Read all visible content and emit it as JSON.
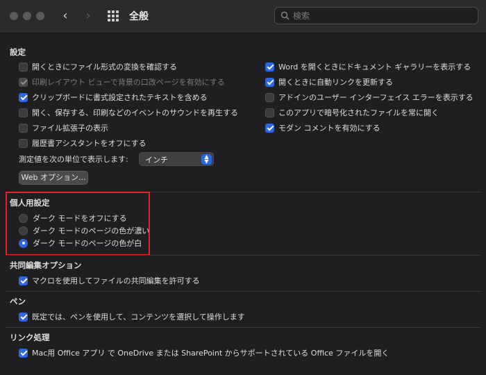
{
  "window": {
    "title": "全般",
    "search_placeholder": "検索"
  },
  "settings": {
    "heading": "設定",
    "left": [
      {
        "label": "開くときにファイル形式の変換を確認する",
        "checked": false,
        "disabled": false
      },
      {
        "label": "印刷レイアウト ビューで背景の口改ページを有効にする",
        "checked": true,
        "disabled": true
      },
      {
        "label": "クリップボードに書式設定されたテキストを含める",
        "checked": true,
        "disabled": false
      },
      {
        "label": "開く、保存する、印刷などのイベントのサウンドを再生する",
        "checked": false,
        "disabled": false
      },
      {
        "label": "ファイル拡張子の表示",
        "checked": false,
        "disabled": false
      },
      {
        "label": "履歴書アシスタントをオフにする",
        "checked": false,
        "disabled": false
      }
    ],
    "right": [
      {
        "label": "Word を開くときにドキュメント ギャラリーを表示する",
        "checked": true,
        "disabled": false
      },
      {
        "label": "開くときに自動リンクを更新する",
        "checked": true,
        "disabled": false
      },
      {
        "label": "アドインのユーザー インターフェイス エラーを表示する",
        "checked": false,
        "disabled": false
      },
      {
        "label": "このアプリで暗号化されたファイルを常に開く",
        "checked": false,
        "disabled": false
      },
      {
        "label": "モダン コメントを有効にする",
        "checked": true,
        "disabled": false
      }
    ],
    "units_label": "測定値を次の単位で表示します:",
    "units_value": "インチ",
    "web_options_label": "Web オプション..."
  },
  "personal": {
    "heading": "個人用設定",
    "options": [
      {
        "label": "ダーク モードをオフにする",
        "selected": false
      },
      {
        "label": "ダーク モードのページの色が濃い",
        "selected": false
      },
      {
        "label": "ダーク モードのページの色が白",
        "selected": true
      }
    ]
  },
  "coauthoring": {
    "heading": "共同編集オプション",
    "option": {
      "label": "マクロを使用してファイルの共同編集を許可する",
      "checked": true
    }
  },
  "pen": {
    "heading": "ペン",
    "option": {
      "label": "既定では、ペンを使用して、コンテンツを選択して操作します",
      "checked": true
    }
  },
  "links": {
    "heading": "リンク処理",
    "option": {
      "label": "Mac用 Office アプリ で OneDrive または SharePoint からサポートされている Office ファイルを開く",
      "checked": true
    }
  },
  "colors": {
    "accent": "#2c67e0",
    "highlight": "#e02424",
    "background": "#1f1f21"
  }
}
